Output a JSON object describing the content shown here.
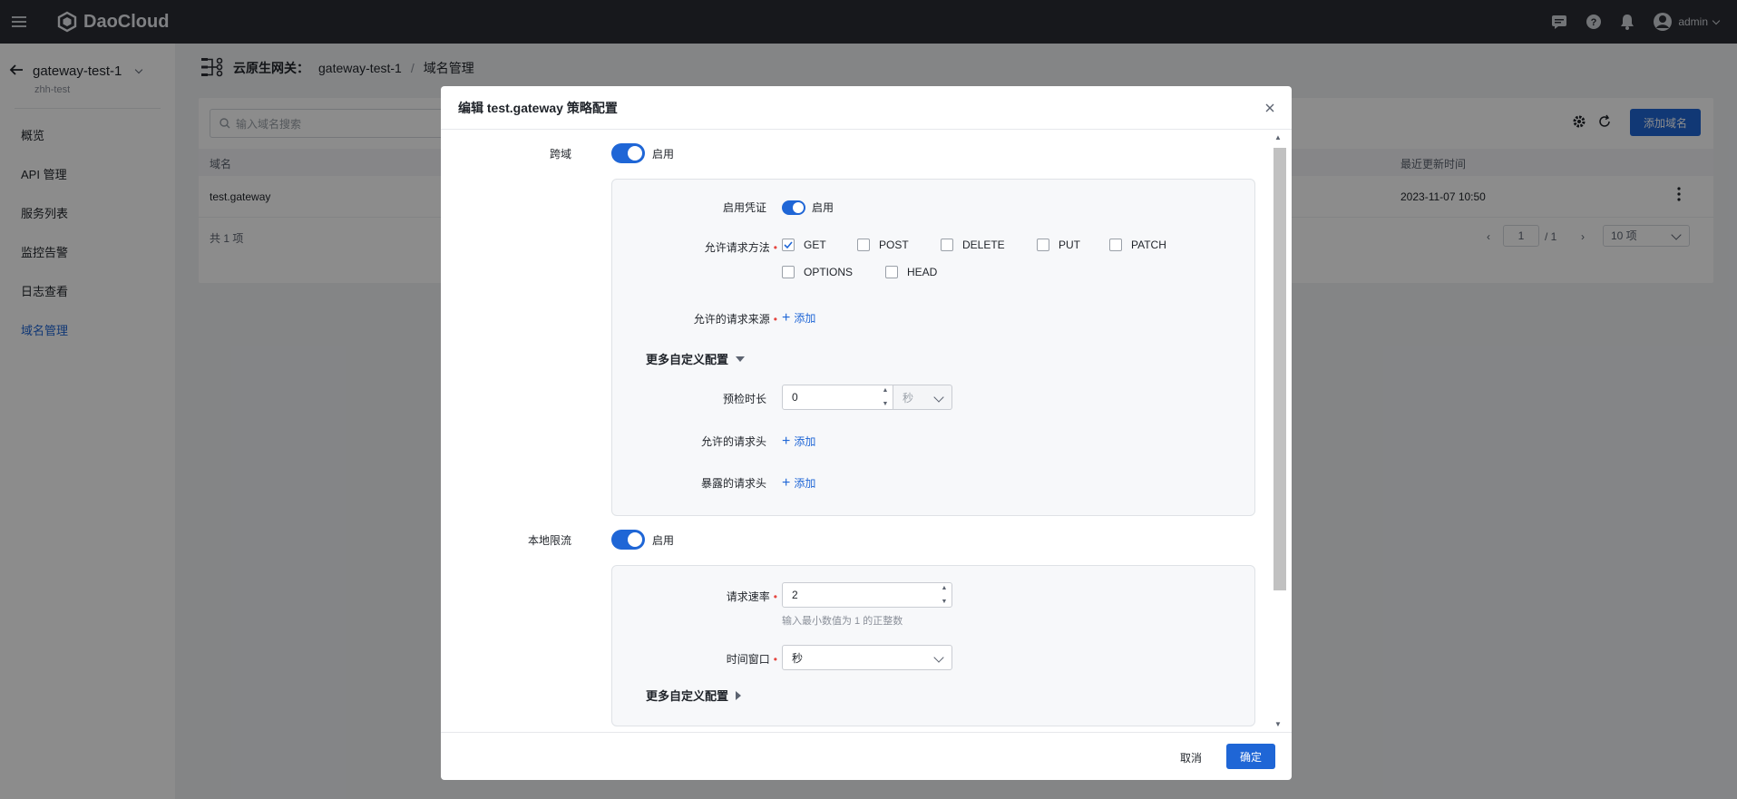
{
  "topbar": {
    "brand": "DaoCloud",
    "user": "admin"
  },
  "sidebar": {
    "gateway": "gateway-test-1",
    "workspace": "zhh-test",
    "items": [
      {
        "label": "概览"
      },
      {
        "label": "API 管理"
      },
      {
        "label": "服务列表"
      },
      {
        "label": "监控告警"
      },
      {
        "label": "日志查看"
      },
      {
        "label": "域名管理",
        "active": true
      }
    ]
  },
  "breadcrumb": {
    "section": "云原生网关：",
    "gateway": "gateway-test-1",
    "sep": "/",
    "current": "域名管理"
  },
  "list": {
    "search_placeholder": "输入域名搜索",
    "add_button": "添加域名",
    "columns": {
      "domain": "域名",
      "updated": "最近更新时间"
    },
    "rows": [
      {
        "domain": "test.gateway",
        "updated": "2023-11-07 10:50"
      }
    ],
    "total": "共 1 项",
    "page_current": "1",
    "page_total": "/ 1",
    "page_size": "10 项"
  },
  "modal": {
    "title": "编辑 test.gateway 策略配置",
    "cors": {
      "label": "跨域",
      "enabled_label": "启用",
      "credentials_label": "启用凭证",
      "credentials_enabled_label": "启用",
      "methods_label": "允许请求方法",
      "methods": [
        {
          "name": "GET",
          "checked": true
        },
        {
          "name": "POST",
          "checked": false
        },
        {
          "name": "DELETE",
          "checked": false
        },
        {
          "name": "PUT",
          "checked": false
        },
        {
          "name": "PATCH",
          "checked": false
        },
        {
          "name": "OPTIONS",
          "checked": false
        },
        {
          "name": "HEAD",
          "checked": false
        }
      ],
      "origins_label": "允许的请求来源",
      "add_label": "添加",
      "more_label": "更多自定义配置",
      "preflight_label": "预检时长",
      "preflight_value": "0",
      "preflight_unit": "秒",
      "allow_headers_label": "允许的请求头",
      "expose_headers_label": "暴露的请求头"
    },
    "ratelimit": {
      "label": "本地限流",
      "enabled_label": "启用",
      "rate_label": "请求速率",
      "rate_value": "2",
      "rate_hint": "输入最小数值为 1 的正整数",
      "window_label": "时间窗口",
      "window_value": "秒",
      "more_label": "更多自定义配置"
    },
    "cancel": "取消",
    "confirm": "确定"
  }
}
